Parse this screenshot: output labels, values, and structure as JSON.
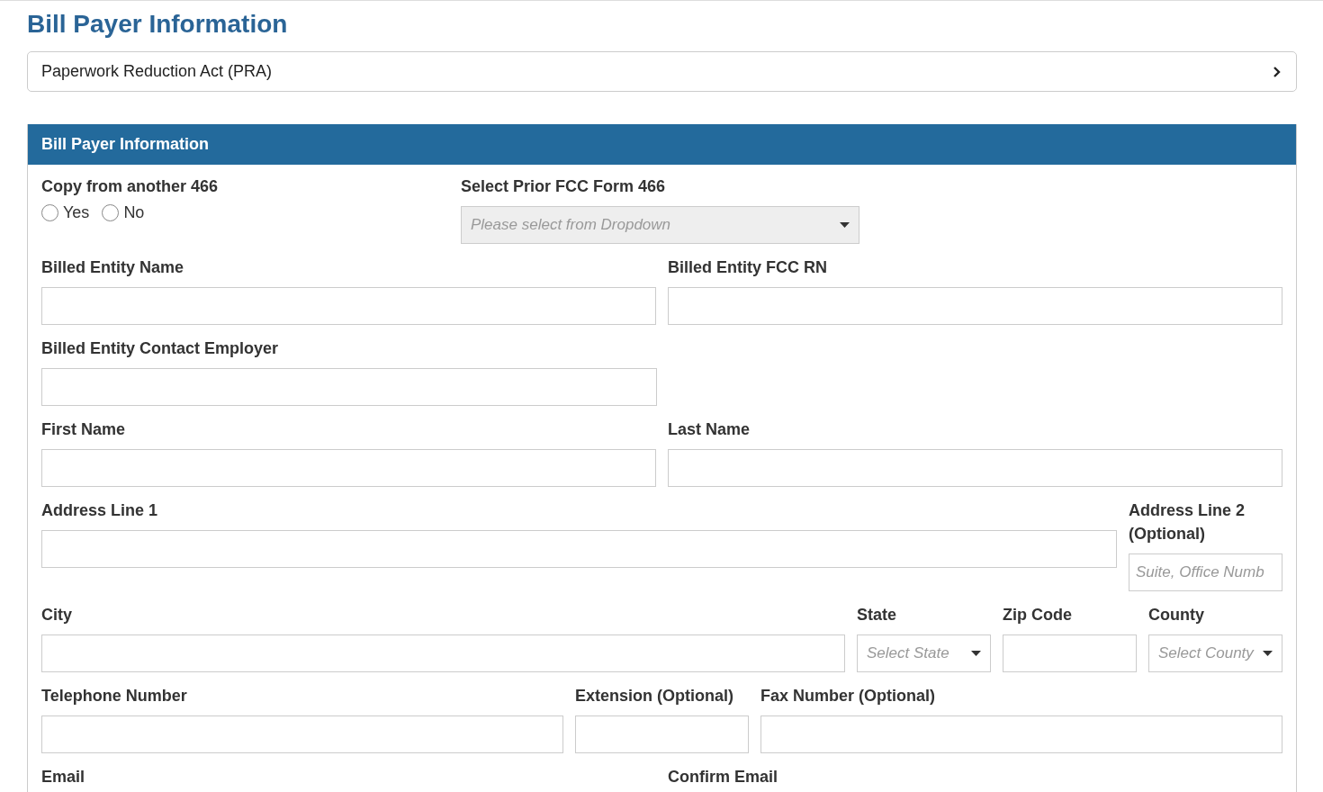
{
  "page_title": "Bill Payer Information",
  "accordion": {
    "label": "Paperwork Reduction Act (PRA)",
    "expanded": false
  },
  "panel": {
    "title": "Bill Payer Information",
    "rows": [
      {
        "fields": [
          {
            "kind": "radio",
            "label": "Copy from another 466",
            "options": [
              {
                "label": "Yes",
                "selected": false
              },
              {
                "label": "No",
                "selected": false
              }
            ]
          },
          {
            "kind": "select",
            "label": "Select Prior FCC Form 466",
            "placeholder": "Please select from Dropdown",
            "disabled": true
          }
        ]
      },
      {
        "fields": [
          {
            "kind": "text",
            "label": "Billed Entity Name"
          },
          {
            "kind": "text",
            "label": "Billed Entity FCC RN"
          }
        ]
      },
      {
        "fields": [
          {
            "kind": "text",
            "label": "Billed Entity Contact Employer"
          }
        ]
      },
      {
        "fields": [
          {
            "kind": "text",
            "label": "First Name"
          },
          {
            "kind": "text",
            "label": "Last Name"
          }
        ]
      },
      {
        "fields": [
          {
            "kind": "text",
            "label": "Address Line 1"
          },
          {
            "kind": "text",
            "label": "Address Line 2 (Optional)",
            "placeholder": "Suite, Office Numb"
          }
        ]
      },
      {
        "fields": [
          {
            "kind": "text",
            "label": "City"
          },
          {
            "kind": "select",
            "label": "State",
            "placeholder": "Select State",
            "disabled": false
          },
          {
            "kind": "text",
            "label": "Zip Code"
          },
          {
            "kind": "select",
            "label": "County",
            "placeholder": "Select County",
            "disabled": false
          }
        ]
      },
      {
        "fields": [
          {
            "kind": "text",
            "label": "Telephone Number"
          },
          {
            "kind": "text",
            "label": "Extension (Optional)"
          },
          {
            "kind": "text",
            "label": "Fax Number (Optional)"
          }
        ]
      },
      {
        "fields": [
          {
            "kind": "text",
            "label": "Email"
          },
          {
            "kind": "text",
            "label": "Confirm Email"
          }
        ]
      }
    ]
  }
}
